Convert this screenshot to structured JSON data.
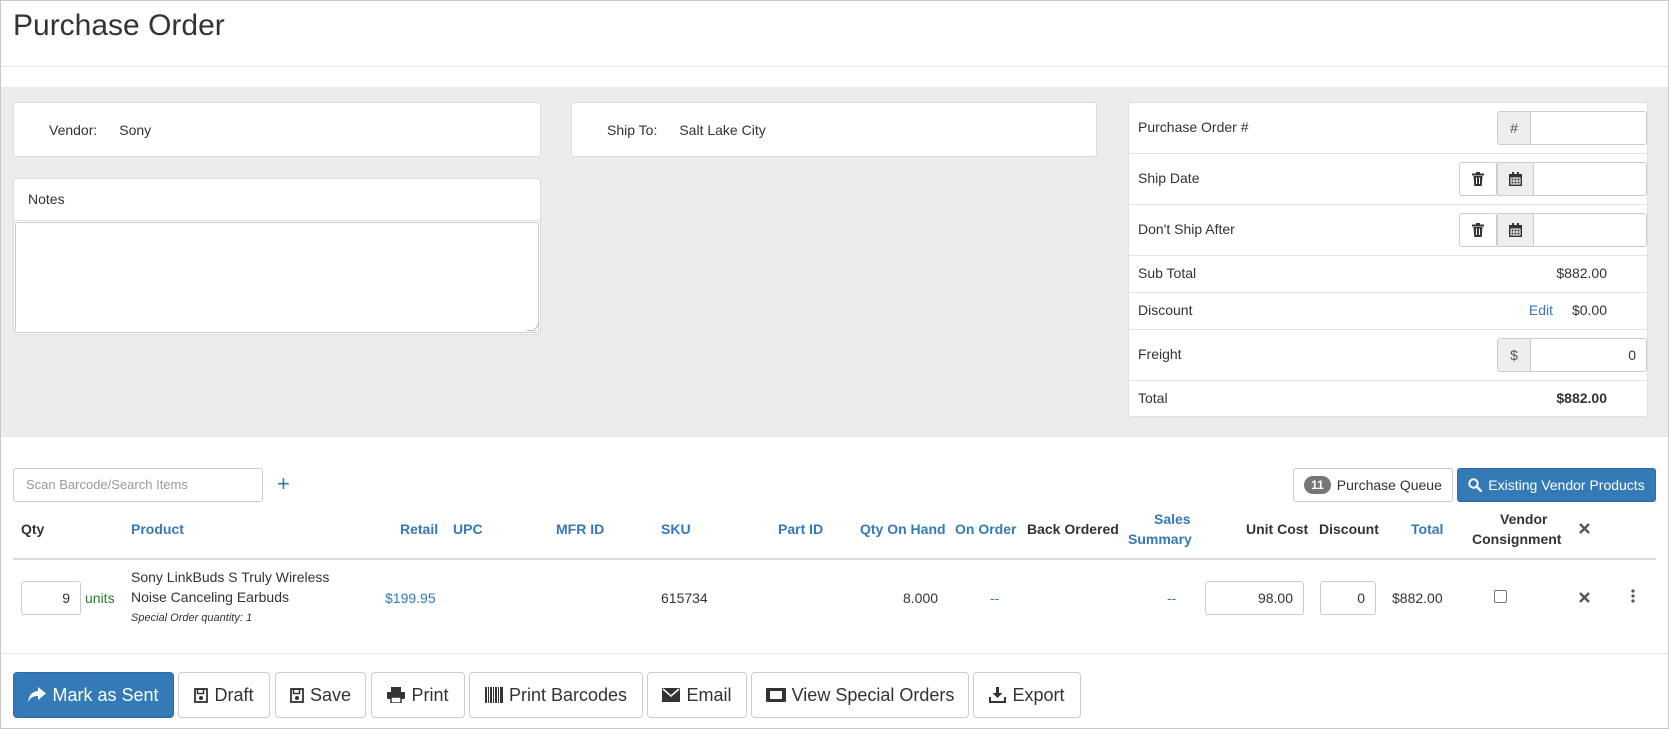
{
  "page": {
    "title": "Purchase Order"
  },
  "vendor": {
    "label": "Vendor:",
    "value": "Sony"
  },
  "ship_to": {
    "label": "Ship To:",
    "value": "Salt Lake City"
  },
  "notes": {
    "label": "Notes",
    "value": ""
  },
  "summary": {
    "po_number": {
      "label": "Purchase Order #",
      "addon": "#",
      "value": ""
    },
    "ship_date": {
      "label": "Ship Date",
      "value": ""
    },
    "dont_ship_after": {
      "label": "Don't Ship After",
      "value": ""
    },
    "sub_total": {
      "label": "Sub Total",
      "value": "$882.00"
    },
    "discount": {
      "label": "Discount",
      "edit_label": "Edit",
      "value": "$0.00"
    },
    "freight": {
      "label": "Freight",
      "addon": "$",
      "value": "0"
    },
    "total": {
      "label": "Total",
      "value": "$882.00"
    }
  },
  "search": {
    "placeholder": "Scan Barcode/Search Items",
    "add_label": "+"
  },
  "toolbar": {
    "purchase_queue": {
      "count": "11",
      "label": "Purchase Queue"
    },
    "existing_vendor_products": "Existing Vendor Products"
  },
  "table": {
    "headers": {
      "qty": "Qty",
      "product": "Product",
      "retail": "Retail",
      "upc": "UPC",
      "mfr_id": "MFR ID",
      "sku": "SKU",
      "part_id": "Part ID",
      "qty_on_hand": "Qty On Hand",
      "on_order": "On Order",
      "back_ordered": "Back Ordered",
      "sales_summary_1": "Sales",
      "sales_summary_2": "Summary",
      "unit_cost": "Unit Cost",
      "discount": "Discount",
      "total": "Total",
      "vendor_consignment_1": "Vendor",
      "vendor_consignment_2": "Consignment"
    },
    "rows": [
      {
        "qty": "9",
        "units": "units",
        "product_line1": "Sony LinkBuds S Truly Wireless",
        "product_line2": "Noise Canceling Earbuds",
        "special_note": "Special Order quantity: 1",
        "retail": "$199.95",
        "upc": "",
        "mfr_id": "",
        "sku": "615734",
        "part_id": "",
        "qty_on_hand": "8.000",
        "on_order": "--",
        "back_ordered": "",
        "sales_summary": "--",
        "unit_cost": "98.00",
        "discount": "0",
        "total": "$882.00",
        "vendor_consignment": false
      }
    ]
  },
  "actions": {
    "mark_as_sent": "Mark as Sent",
    "draft": "Draft",
    "save": "Save",
    "print": "Print",
    "print_barcodes": "Print Barcodes",
    "email": "Email",
    "view_special_orders": "View Special Orders",
    "export": "Export"
  },
  "colors": {
    "primary": "#337ab7",
    "link": "#337ab7",
    "units": "#2e7d32",
    "band": "#ececec"
  }
}
